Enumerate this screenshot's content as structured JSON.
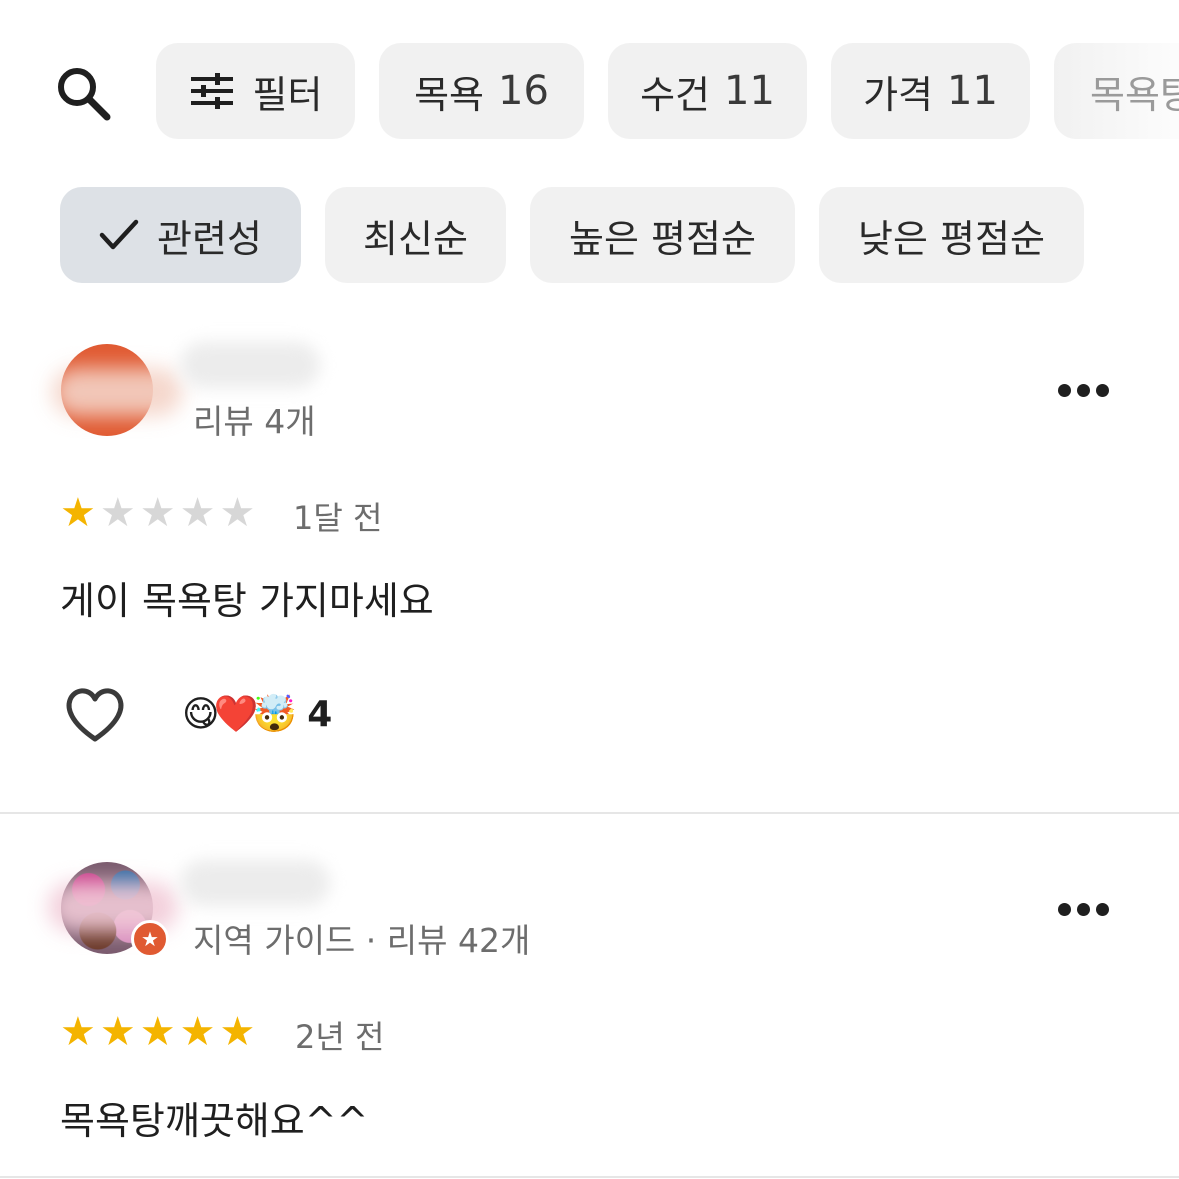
{
  "filters": {
    "search_icon": "search-icon",
    "filter_label": "필터",
    "filter_icon": "sliders-icon",
    "topics": [
      {
        "label": "목욕",
        "count": "16"
      },
      {
        "label": "수건",
        "count": "11"
      },
      {
        "label": "가격",
        "count": "11"
      }
    ],
    "partial_topic": "목욕탕"
  },
  "sort": {
    "check_icon": "check-icon",
    "options": [
      "관련성",
      "최신순",
      "높은 평점순",
      "낮은 평점순"
    ],
    "selected": "관련성"
  },
  "reviews": [
    {
      "meta": "리뷰 4개",
      "rating": 1,
      "max_rating": 5,
      "when": "1달 전",
      "text": "게이 목욕탕 가지마세요",
      "reactions": [
        "😋",
        "❤️",
        "🤯"
      ],
      "reaction_count": "4"
    },
    {
      "meta": "지역 가이드 · 리뷰 42개",
      "rating": 5,
      "max_rating": 5,
      "when": "2년 전",
      "text": "목욕탕깨끗해요^^"
    }
  ],
  "colors": {
    "accent_star": "#f4b400",
    "avatar_orange": "#e05a32",
    "chip_bg": "#f1f1f1",
    "chip_selected_bg": "#dde1e6"
  }
}
